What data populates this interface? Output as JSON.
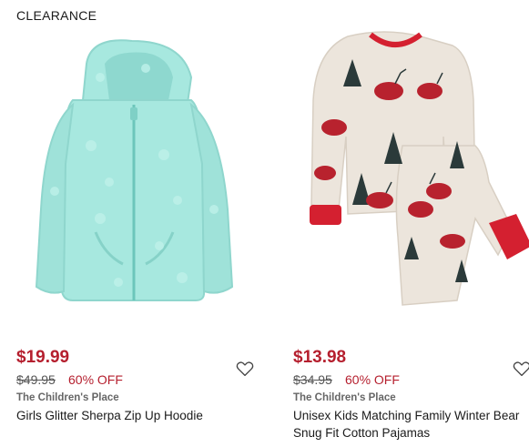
{
  "clearance_label": "CLEARANCE",
  "products": [
    {
      "sale_price": "$19.99",
      "original_price": "$49.95",
      "discount": "60% OFF",
      "brand": "The Children's Place",
      "title": "Girls Glitter Sherpa Zip Up Hoodie",
      "icon": "heart-outline-icon"
    },
    {
      "sale_price": "$13.98",
      "original_price": "$34.95",
      "discount": "60% OFF",
      "brand": "The Children's Place",
      "title": "Unisex Kids Matching Family Winter Bear Snug Fit Cotton Pajamas",
      "icon": "heart-outline-icon"
    }
  ],
  "colors": {
    "sale": "#b51f2e",
    "hoodie": "#a7e8df",
    "pajama_base": "#ece5dc",
    "pajama_cuff": "#d42030"
  }
}
